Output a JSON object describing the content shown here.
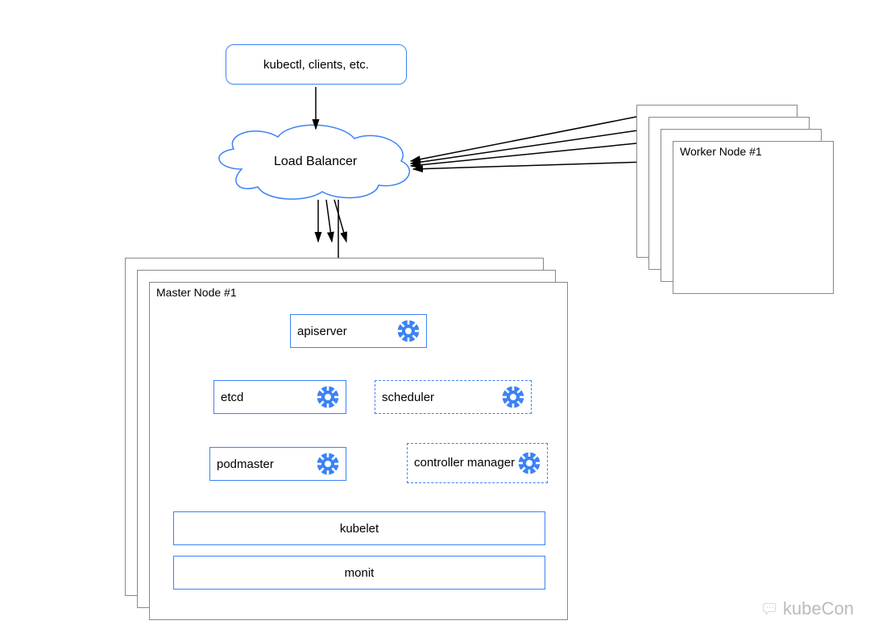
{
  "diagram": {
    "clients": "kubectl, clients, etc.",
    "loadBalancer": "Load Balancer",
    "workerNodes": {
      "front": "Worker Node #1"
    },
    "masterNodes": {
      "front": "Master Node #1",
      "components": {
        "apiserver": "apiserver",
        "etcd": "etcd",
        "scheduler": "scheduler",
        "podmaster": "podmaster",
        "controllerManager": "controller manager",
        "kubelet": "kubelet",
        "monit": "monit"
      }
    }
  },
  "watermark": "kubeCon"
}
